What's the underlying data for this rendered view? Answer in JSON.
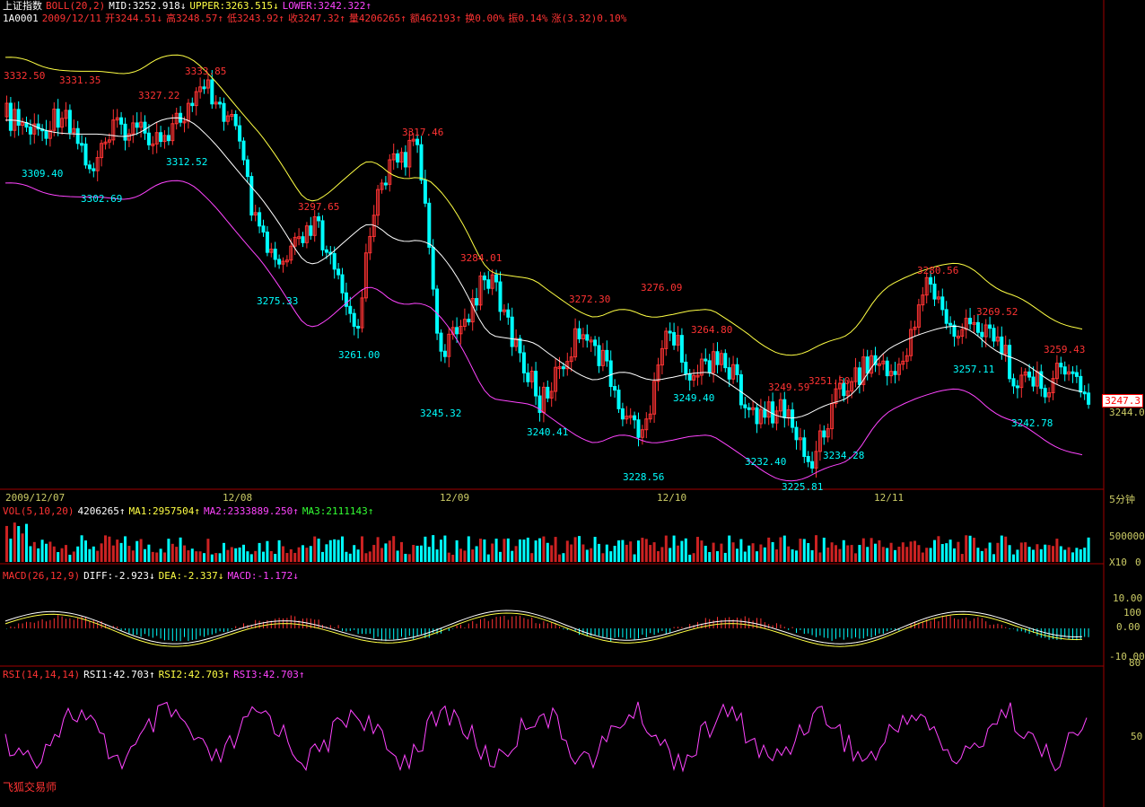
{
  "header": {
    "symbol": "上证指数",
    "indicator": "BOLL(20,2)",
    "mid": "MID:3252.918↓",
    "upper": "UPPER:3263.515↓",
    "lower": "LOWER:3242.322↑",
    "code": "1A0001",
    "date": "2009/12/11",
    "open": "开3244.51↓",
    "high": "高3248.57↑",
    "low": "低3243.92↑",
    "close": "收3247.32↑",
    "volume": "量4206265↑",
    "amount": "额462193↑",
    "turnover": "换0.00%",
    "amplitude": "振0.14%",
    "change": "涨(3.32)0.10%"
  },
  "price_tag": "3247.3",
  "right_axis": {
    "price_ref": "3244.0",
    "period": "5分钟"
  },
  "time_axis": [
    "2009/12/07",
    "12/08",
    "12/09",
    "12/10",
    "12/11"
  ],
  "labels_high": [
    "3332.50",
    "3331.35",
    "3327.22",
    "3333.85",
    "3317.46",
    "3297.65",
    "3284.01",
    "3272.30",
    "3276.09",
    "3264.80",
    "3249.59",
    "3251.50",
    "3280.56",
    "3269.52",
    "3259.43"
  ],
  "labels_low": [
    "3309.40",
    "3302.69",
    "3312.52",
    "3275.33",
    "3261.00",
    "3245.32",
    "3240.41",
    "3228.56",
    "3249.40",
    "3232.40",
    "3225.81",
    "3234.28",
    "3257.11",
    "3242.78"
  ],
  "vol_panel": {
    "title": "VOL(5,10,20)",
    "value": "4206265↑",
    "ma1": "MA1:2957504↑",
    "ma2": "MA2:2333889.250↑",
    "ma3": "MA3:2111143↑",
    "axis_top": "500000",
    "axis_unit": "X10",
    "axis_zero": "0"
  },
  "macd_panel": {
    "title": "MACD(26,12,9)",
    "diff": "DIFF:-2.923↓",
    "dea": "DEA:-2.337↓",
    "macd": "MACD:-1.172↓",
    "axis": [
      "10.00",
      "100",
      "0.00",
      "-10.00",
      "80"
    ]
  },
  "rsi_panel": {
    "title": "RSI(14,14,14)",
    "rsi1": "RSI1:42.703↑",
    "rsi2": "RSI2:42.703↑",
    "rsi3": "RSI3:42.703↑",
    "axis": [
      "50"
    ]
  },
  "brand": "飞狐交易师",
  "colors": {
    "up": "#ff3333",
    "down": "#00ffff",
    "mid": "#ffffff",
    "upper": "#ffff44",
    "lower": "#ff44ff"
  }
}
